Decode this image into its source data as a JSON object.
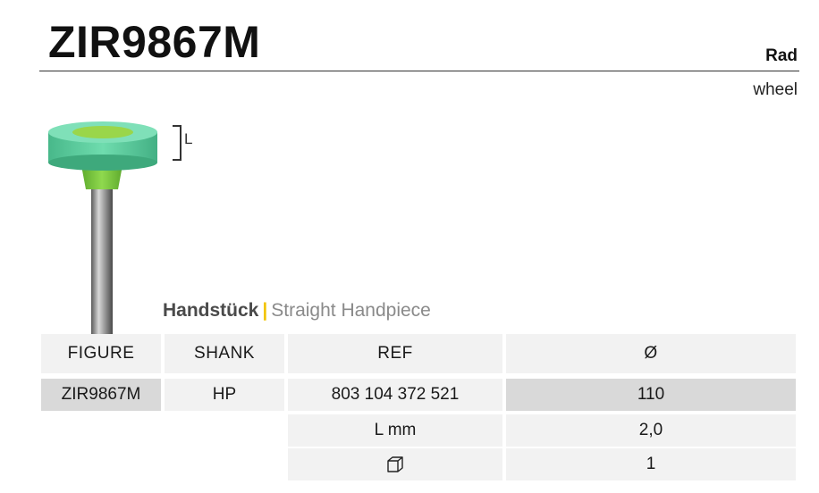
{
  "product": {
    "code": "ZIR9867M",
    "type_de": "Rad",
    "type_en": "wheel"
  },
  "drawing": {
    "dimension_label": "L",
    "colors": {
      "wheel": "#5fd0a0",
      "wheel_center": "#8fd04a",
      "neck": "#7cc940",
      "shank": "#9a9a9a"
    }
  },
  "handpiece": {
    "de": "Handstück",
    "separator": "|",
    "en": "Straight Handpiece"
  },
  "table": {
    "headers": [
      "FIGURE",
      "SHANK",
      "REF",
      "Ø"
    ],
    "row1": {
      "figure": "ZIR9867M",
      "shank": "HP",
      "ref": "803 104 372 521",
      "diameter": "110"
    },
    "row2": {
      "label": "L mm",
      "value": "2,0"
    },
    "row3": {
      "icon": "package-icon",
      "value": "1"
    }
  }
}
